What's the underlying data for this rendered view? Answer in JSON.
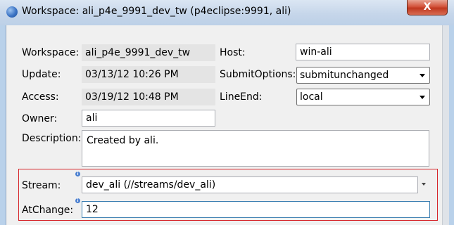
{
  "window": {
    "title": "Workspace: ali_p4e_9991_dev_tw (p4eclipse:9991, ali)",
    "close_label": "X"
  },
  "form": {
    "workspace_label": "Workspace:",
    "workspace_value": "ali_p4e_9991_dev_tw",
    "update_label": "Update:",
    "update_value": "03/13/12 10:26 PM",
    "access_label": "Access:",
    "access_value": "03/19/12 10:48 PM",
    "owner_label": "Owner:",
    "owner_value": "ali",
    "description_label": "Description:",
    "description_value": "Created by ali.",
    "host_label": "Host:",
    "host_value": "win-ali",
    "submitoptions_label": "SubmitOptions:",
    "submitoptions_value": "submitunchanged",
    "lineend_label": "LineEnd:",
    "lineend_value": "local",
    "stream_label": "Stream:",
    "stream_value": "dev_ali (//streams/dev_ali)",
    "atchange_label": "AtChange:",
    "atchange_value": "12"
  },
  "colors": {
    "highlight_border": "#d6262b",
    "close_button": "#c0381f",
    "info_icon": "#4a7fd0"
  },
  "icons": [
    "app-icon",
    "close-icon",
    "chevron-down-icon",
    "info-icon"
  ]
}
